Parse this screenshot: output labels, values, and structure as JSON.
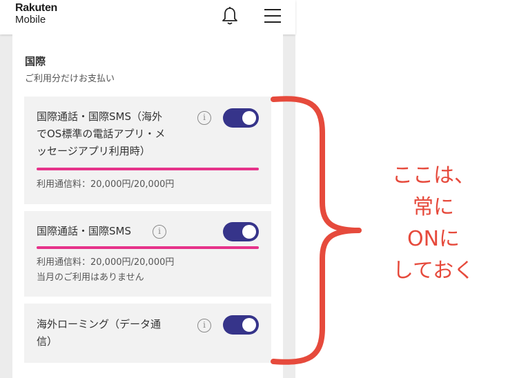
{
  "header": {
    "logo_line1": "Rakuten",
    "logo_line2": "Mobile"
  },
  "icons": {
    "notification": "bell-icon",
    "menu": "hamburger-menu-icon",
    "info": "info-icon"
  },
  "section": {
    "title": "国際",
    "subtitle": "ご利用分だけお支払い"
  },
  "items": [
    {
      "title_lines": [
        "国際通話・国際SMS（海外",
        "でOS標準の電話アプリ・メ",
        "ッセージアプリ利用時）"
      ],
      "toggle_on": true,
      "usage_lines": [
        "利用通信料：20,000円/20,000円"
      ]
    },
    {
      "title_lines": [
        "国際通話・国際SMS"
      ],
      "toggle_on": true,
      "usage_lines": [
        "利用通信料：20,000円/20,000円",
        "当月のご利用はありません"
      ]
    },
    {
      "title_lines": [
        "海外ローミング（データ通",
        "信）"
      ],
      "toggle_on": true
    }
  ],
  "annotation": {
    "lines": [
      "ここは、",
      "常に",
      "ONに",
      "しておく"
    ]
  },
  "colors": {
    "toggle": "#36348a",
    "usage_bar": "#e6338a",
    "annotation": "#e64a3c"
  }
}
